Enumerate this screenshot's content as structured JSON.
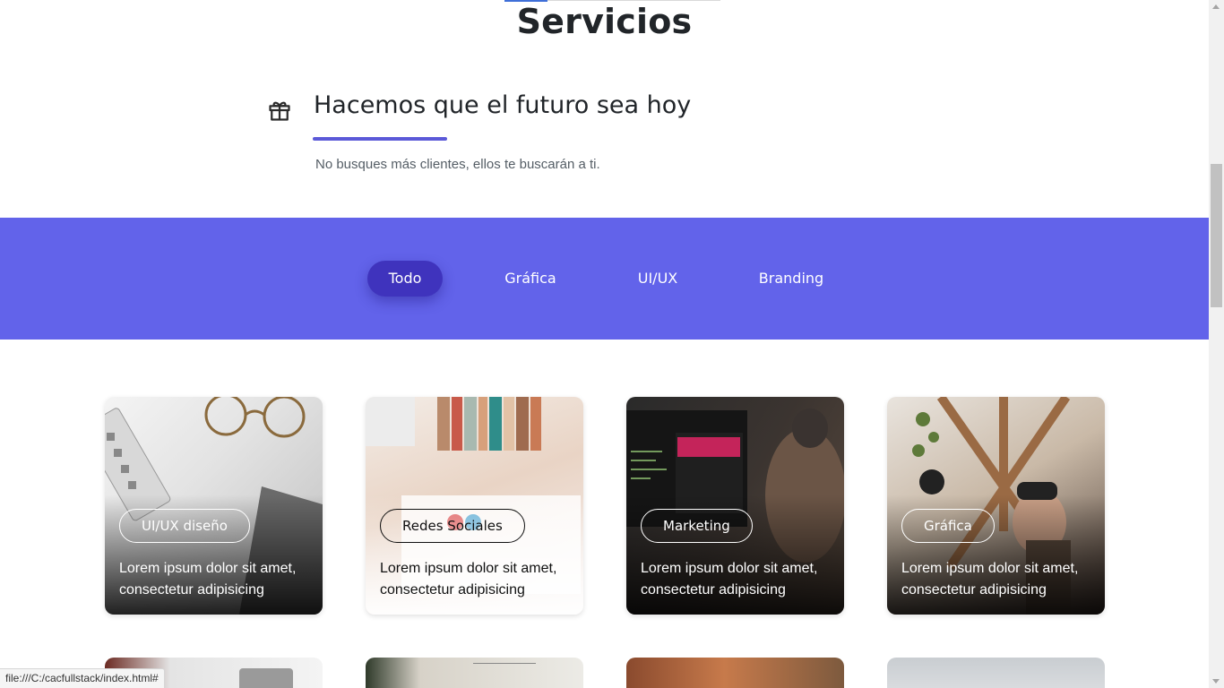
{
  "section": {
    "title": "Servicios"
  },
  "feature": {
    "icon": "gift-icon",
    "heading": "Hacemos que el futuro sea hoy",
    "text": "No busques más clientes, ellos te buscarán a ti."
  },
  "filters": [
    {
      "label": "Todo",
      "active": true
    },
    {
      "label": "Gráfica",
      "active": false
    },
    {
      "label": "UI/UX",
      "active": false
    },
    {
      "label": "Branding",
      "active": false
    }
  ],
  "cards": [
    {
      "tag": "UI/UX diseño",
      "text": "Lorem ipsum dolor sit amet, consectetur adipisicing"
    },
    {
      "tag": "Redes Sociales",
      "text": "Lorem ipsum dolor sit amet, consectetur adipisicing"
    },
    {
      "tag": "Marketing",
      "text": "Lorem ipsum dolor sit amet, consectetur adipisicing"
    },
    {
      "tag": "Gráfica",
      "text": "Lorem ipsum dolor sit amet, consectetur adipisicing"
    }
  ],
  "statusbar": {
    "url": "file:///C:/cacfullstack/index.html#"
  },
  "colors": {
    "accent": "#6263ea",
    "active_filter": "#3f33bd",
    "underline": "#5b59d8"
  }
}
